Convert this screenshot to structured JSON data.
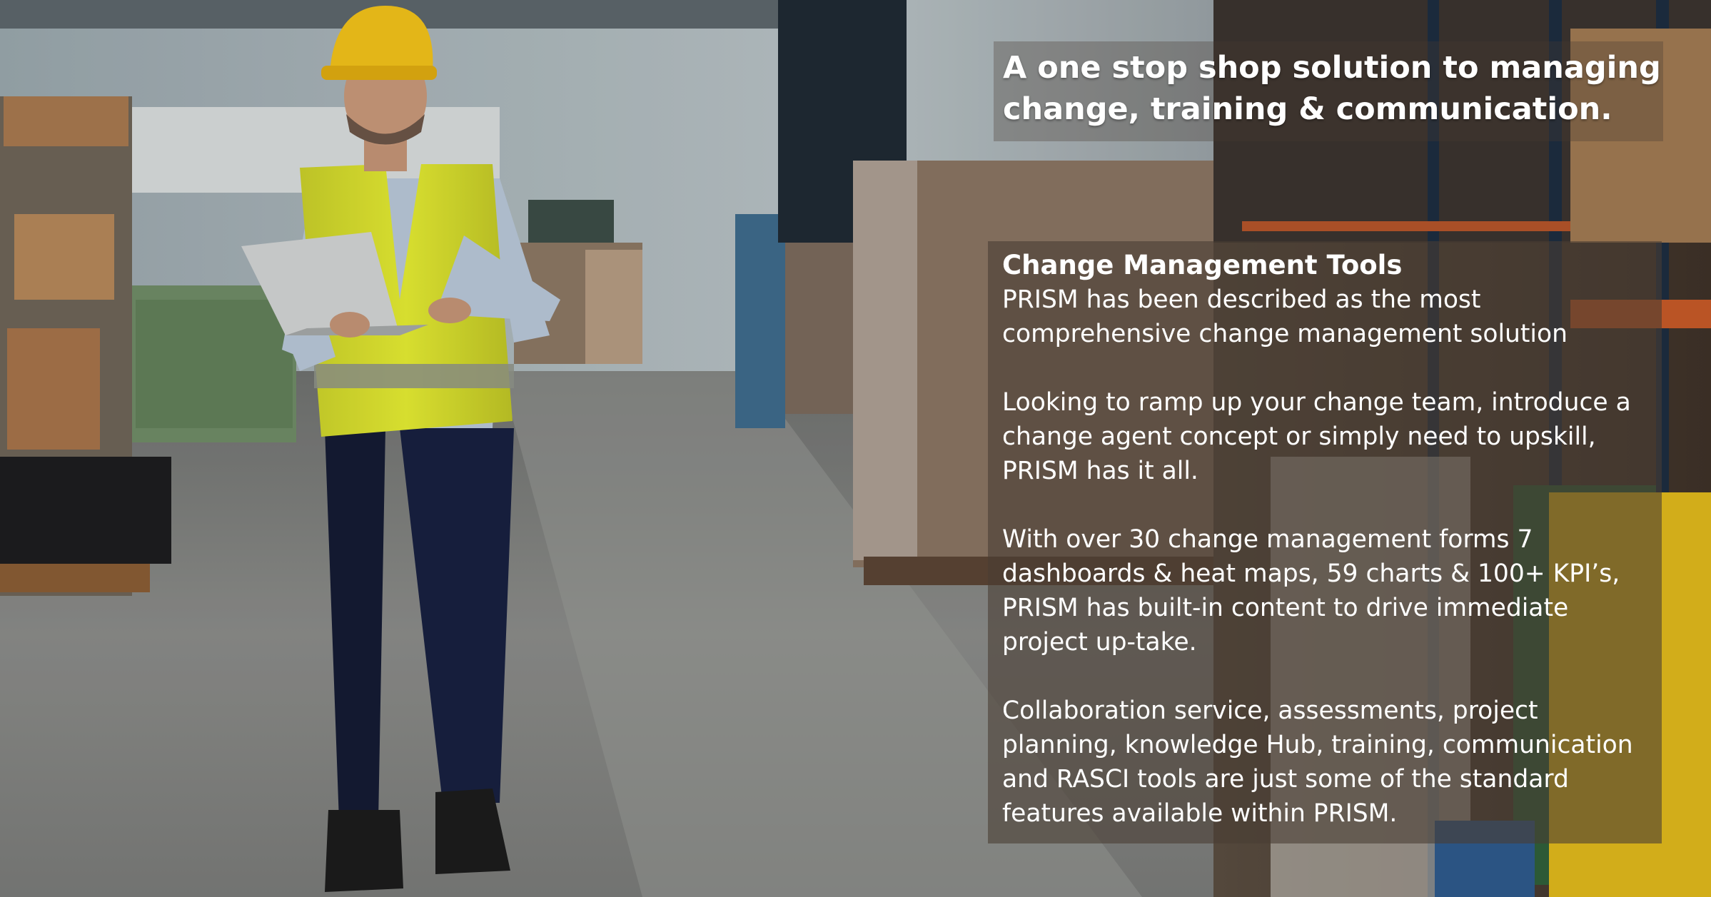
{
  "headline": {
    "line1": "A one stop shop solution to managing",
    "line2": "change, training & communication."
  },
  "panel": {
    "title": "Change Management Tools",
    "paragraphs": [
      "PRISM has been described as the most comprehensive change management solution",
      "Looking to ramp up your change team, introduce a change agent concept or simply need to upskill, PRISM has it all.",
      "With over 30 change management forms 7 dashboards & heat maps, 59 charts & 100+ KPI’s, PRISM has built-in content to drive immediate project up-take.",
      "Collaboration service, assessments, project planning, knowledge Hub, training, communication and RASCI tools are just some of the standard features available within PRISM."
    ]
  },
  "colors": {
    "hard_hat": "#f2c21a",
    "vest": "#e3ea2c",
    "floor": "#8a8a88"
  },
  "icons": [
    "warehouse-photo"
  ]
}
